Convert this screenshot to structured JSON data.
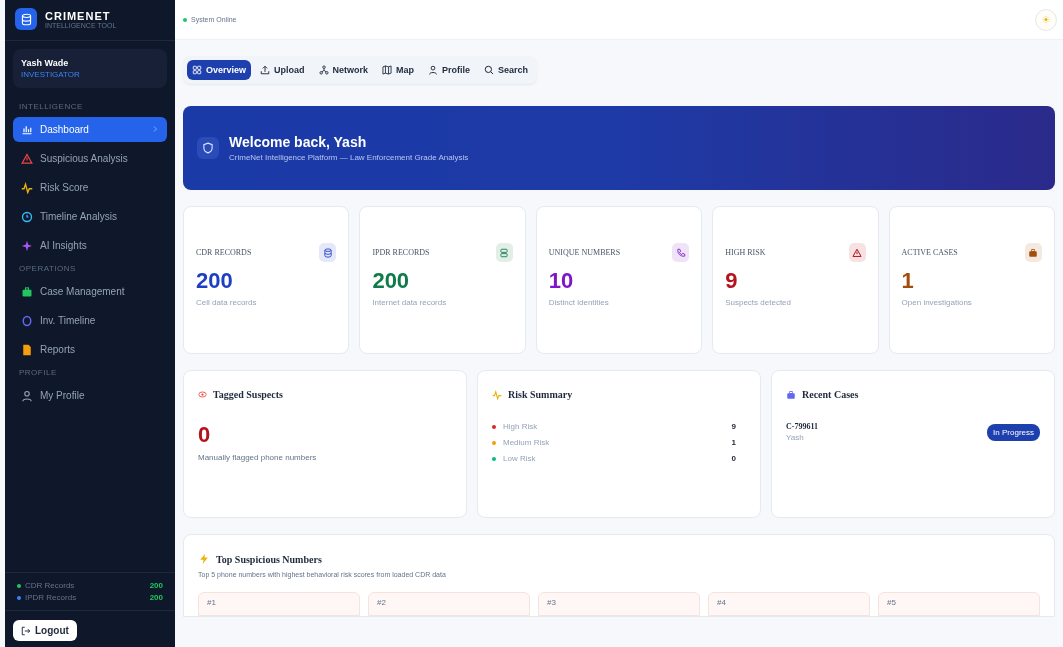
{
  "sidebar": {
    "brand": {
      "name": "CRIMENET",
      "tagline": "INTELLIGENCE TOOL"
    },
    "user": {
      "name": "Yash Wade",
      "role": "INVESTIGATOR"
    },
    "sections": [
      {
        "label": "INTELLIGENCE",
        "items": [
          {
            "label": "Dashboard",
            "kind": "chart",
            "selected": true
          },
          {
            "label": "Suspicious Analysis",
            "kind": "alert",
            "selected": false
          },
          {
            "label": "Risk Score",
            "kind": "pulse",
            "selected": false
          },
          {
            "label": "Timeline Analysis",
            "kind": "clock",
            "selected": false
          },
          {
            "label": "AI Insights",
            "kind": "sparkle",
            "selected": false
          }
        ]
      },
      {
        "label": "OPERATIONS",
        "items": [
          {
            "label": "Case Management",
            "kind": "briefcase",
            "selected": false
          },
          {
            "label": "Inv. Timeline",
            "kind": "ring",
            "selected": false
          },
          {
            "label": "Reports",
            "kind": "file",
            "selected": false
          }
        ]
      },
      {
        "label": "PROFILE",
        "items": [
          {
            "label": "My Profile",
            "kind": "user",
            "selected": false
          }
        ]
      }
    ],
    "stats": [
      {
        "label": "CDR Records",
        "value": "200",
        "color": "#22c55e"
      },
      {
        "label": "IPDR Records",
        "value": "200",
        "color": "#3b82f6"
      }
    ],
    "logout": "Logout"
  },
  "header": {
    "status": "System Online"
  },
  "tabs": [
    {
      "label": "Overview",
      "kind": "grid",
      "selected": true
    },
    {
      "label": "Upload",
      "kind": "upload",
      "selected": false
    },
    {
      "label": "Network",
      "kind": "network",
      "selected": false
    },
    {
      "label": "Map",
      "kind": "map",
      "selected": false
    },
    {
      "label": "Profile",
      "kind": "user",
      "selected": false
    },
    {
      "label": "Search",
      "kind": "search",
      "selected": false
    }
  ],
  "banner": {
    "title": "Welcome back, Yash",
    "subtitle": "CrimeNet Intelligence Platform — Law Enforcement Grade Analysis"
  },
  "stat_cards": [
    {
      "label": "CDR RECORDS",
      "value": "200",
      "caption": "Cell data records",
      "kind": "database",
      "color": "#1d3fc4"
    },
    {
      "label": "IPDR RECORDS",
      "value": "200",
      "caption": "Internet data records",
      "kind": "server",
      "color": "#0f7a4a"
    },
    {
      "label": "UNIQUE NUMBERS",
      "value": "10",
      "caption": "Distinct identities",
      "kind": "phone",
      "color": "#7e16c9"
    },
    {
      "label": "HIGH RISK",
      "value": "9",
      "caption": "Suspects detected",
      "kind": "alert",
      "color": "#b3141b"
    },
    {
      "label": "ACTIVE CASES",
      "value": "1",
      "caption": "Open investigations",
      "kind": "briefcase",
      "color": "#a34d0c"
    }
  ],
  "tagged": {
    "title": "Tagged Suspects",
    "value": "0",
    "caption": "Manually flagged phone numbers"
  },
  "risk_summary": {
    "title": "Risk Summary",
    "rows": [
      {
        "label": "High Risk",
        "count": "9",
        "color": "#dc2626"
      },
      {
        "label": "Medium Risk",
        "count": "1",
        "color": "#f59e0b"
      },
      {
        "label": "Low Risk",
        "count": "0",
        "color": "#10b981"
      }
    ]
  },
  "recent_cases": {
    "title": "Recent Cases",
    "cases": [
      {
        "id": "C-799611",
        "owner": "Yash",
        "status": "In Progress"
      }
    ]
  },
  "top_suspicious": {
    "title": "Top Suspicious Numbers",
    "subtitle": "Top 5 phone numbers with highest behavioral risk scores from loaded CDR data",
    "ranks": [
      "#1",
      "#2",
      "#3",
      "#4",
      "#5"
    ]
  }
}
